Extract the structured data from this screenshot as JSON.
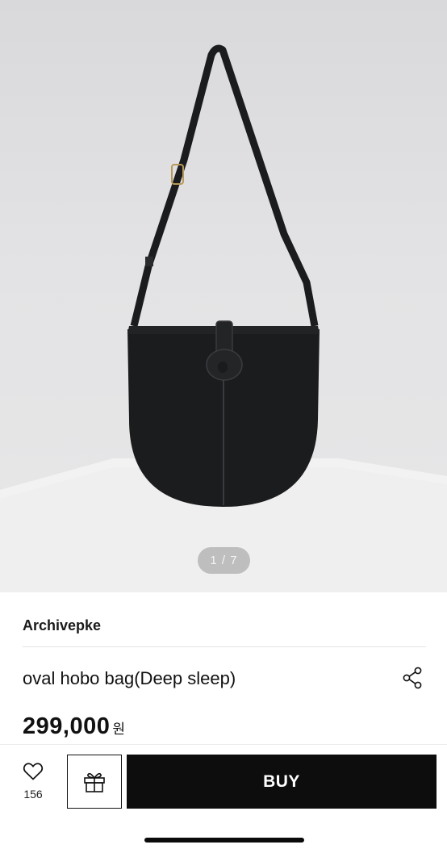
{
  "gallery": {
    "pager_text": "1 / 7"
  },
  "product": {
    "brand": "Archivepke",
    "title": "oval hobo bag(Deep sleep)",
    "price": "299,000",
    "currency": "원"
  },
  "actions": {
    "like_count": "156",
    "buy_label": "BUY"
  },
  "icons": {
    "share": "share-icon",
    "heart": "heart-icon",
    "gift": "gift-icon"
  },
  "colors": {
    "buy_button": "#0d0d0d",
    "bag": "#1b1c1e"
  }
}
